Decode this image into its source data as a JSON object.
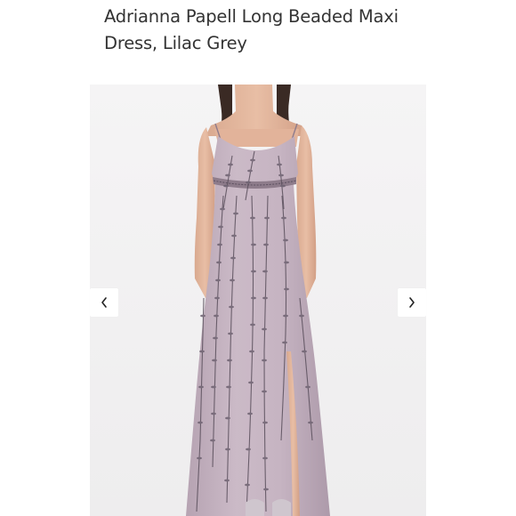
{
  "product": {
    "title": "Adrianna Papell Long Beaded Maxi Dress, Lilac Grey"
  },
  "gallery": {
    "prev_icon": "chevron-left-icon",
    "next_icon": "chevron-right-icon"
  },
  "colors": {
    "dress": "#c4b2bf",
    "beading": "#5a4f5c",
    "background": "#f3f2f3",
    "text": "#333333"
  }
}
